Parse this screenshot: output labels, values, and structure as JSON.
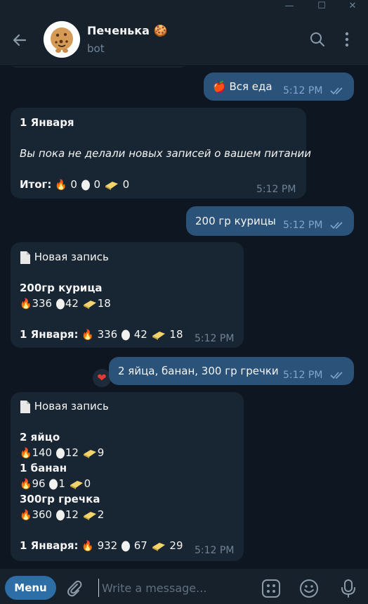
{
  "window": {
    "minimize_glyph": "—",
    "maximize_glyph": "☐",
    "close_glyph": "✕"
  },
  "header": {
    "title": "Печенька 🍪",
    "subtitle": "bot"
  },
  "messages": [
    {
      "id": "m1",
      "direction": "out",
      "text": "🍎 Вся еда",
      "time": "5:12 PM",
      "read": true
    },
    {
      "id": "m2",
      "direction": "in",
      "date_title": "1 Января",
      "empty_notice": "Вы пока не делали новых записей о вашем питании",
      "total_label": "Итог:",
      "calories": "0",
      "protein": "0",
      "fat": "0",
      "time": "5:12 PM"
    },
    {
      "id": "m3",
      "direction": "out",
      "text": "200 гр курицы",
      "time": "5:12 PM",
      "read": true
    },
    {
      "id": "m4",
      "direction": "in",
      "header": "Новая запись",
      "items": [
        {
          "name": "200гр курица",
          "calories": "336",
          "protein": "42",
          "fat": "18"
        }
      ],
      "summary_label": "1 Января:",
      "calories": "336",
      "protein": "42",
      "fat": "18",
      "time": "5:12 PM"
    },
    {
      "id": "m5",
      "direction": "out",
      "text": "2 яйца, банан, 300 гр гречки",
      "time": "5:12 PM",
      "read": true,
      "reaction": "❤"
    },
    {
      "id": "m6",
      "direction": "in",
      "header": "Новая запись",
      "items": [
        {
          "name": "2 яйцо",
          "calories": "140",
          "protein": "12",
          "fat": "9"
        },
        {
          "name": "1 банан",
          "calories": "96",
          "protein": "1",
          "fat": "0"
        },
        {
          "name": "300гр гречка",
          "calories": "360",
          "protein": "12",
          "fat": "2"
        }
      ],
      "summary_label": "1 Января:",
      "calories": "932",
      "protein": "67",
      "fat": "29",
      "time": "5:12 PM"
    }
  ],
  "composer": {
    "menu_label": "Menu",
    "placeholder": "Write a message..."
  },
  "icons": {
    "fire": "🔥",
    "egg": "egg-icon",
    "butter": "butter-icon",
    "document": "document-icon"
  },
  "colors": {
    "background": "#0e1621",
    "header": "#17212b",
    "incoming_bubble": "#182533",
    "outgoing_bubble": "#2b5278",
    "accent": "#2e6ea6"
  }
}
